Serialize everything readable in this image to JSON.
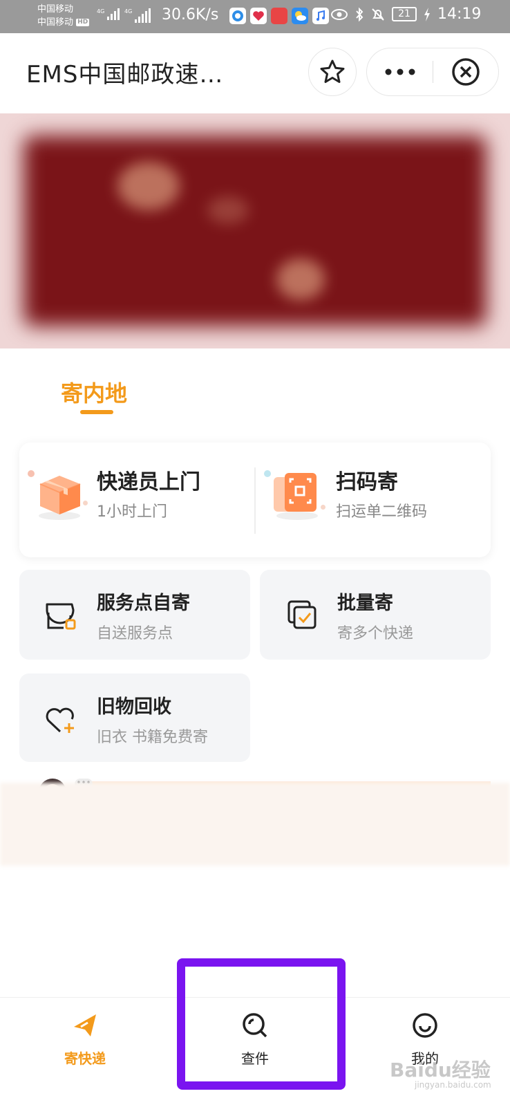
{
  "status_bar": {
    "carrier_1": "中国移动",
    "carrier_2": "中国移动",
    "carrier_2_badge": "HD",
    "signal_1_label": "4G",
    "signal_2_label": "4G",
    "speed": "30.6K/s",
    "battery": "21",
    "time": "14:19",
    "app_icons": [
      "browser-icon",
      "huawei-icon",
      "huawei-store-icon",
      "weather-icon",
      "music-icon"
    ],
    "system_icons": [
      "eye-icon",
      "bluetooth-icon",
      "mute-icon",
      "charging-icon"
    ]
  },
  "top_bar": {
    "title": "EMS中国邮政速…",
    "icons": [
      "star-icon",
      "more-icon",
      "close-icon"
    ]
  },
  "tab": {
    "active_label": "寄内地"
  },
  "main_card": {
    "courier": {
      "title": "快递员上门",
      "subtitle": "1小时上门"
    },
    "scan": {
      "title": "扫码寄",
      "subtitle": "扫运单二维码"
    }
  },
  "tiles": {
    "service_point": {
      "title": "服务点自寄",
      "subtitle": "自送服务点"
    },
    "batch": {
      "title": "批量寄",
      "subtitle": "寄多个快递"
    },
    "recycle": {
      "title": "旧物回收",
      "subtitle": "旧衣 书籍免费寄"
    }
  },
  "tab_bar": {
    "items": [
      {
        "label": "寄快递",
        "icon": "send-icon",
        "active": true
      },
      {
        "label": "查件",
        "icon": "search-icon",
        "active": false
      },
      {
        "label": "我的",
        "icon": "smile-icon",
        "active": false
      }
    ]
  },
  "colors": {
    "accent": "#f39a1b",
    "highlight_box": "#7a14f0",
    "status_bar_bg": "#9a9a9a",
    "tile_bg": "#f4f5f7"
  },
  "watermark": {
    "text": "Baidu经验",
    "sub": "jingyan.baidu.com"
  }
}
